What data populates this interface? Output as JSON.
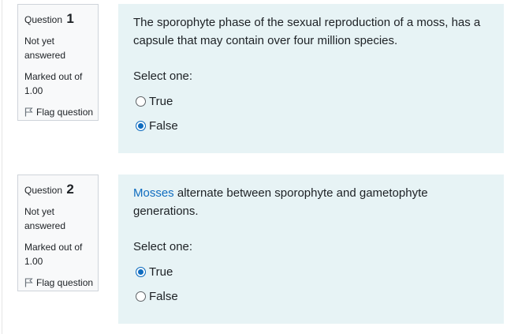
{
  "questions": [
    {
      "label": "Question",
      "number": "1",
      "state": "Not yet answered",
      "grade": "Marked out of 1.00",
      "flag_label": "Flag question",
      "text_link": "",
      "text": "The sporophyte phase of the sexual reproduction of a moss, has a capsule that may contain over four million species.",
      "prompt": "Select one:",
      "options": [
        {
          "label": "True",
          "selected": false
        },
        {
          "label": "False",
          "selected": true
        }
      ]
    },
    {
      "label": "Question",
      "number": "2",
      "state": "Not yet answered",
      "grade": "Marked out of 1.00",
      "flag_label": "Flag question",
      "text_link": "Mosses",
      "text": " alternate between sporophyte and gametophyte generations.",
      "prompt": "Select one:",
      "options": [
        {
          "label": "True",
          "selected": true
        },
        {
          "label": "False",
          "selected": false
        }
      ]
    }
  ],
  "colors": {
    "accent": "#0f6cbf",
    "content_bg": "#e7f3f5",
    "info_bg": "#f8f9fa",
    "info_border": "#cfd4da"
  },
  "icons": {
    "flag": "flag-icon"
  }
}
